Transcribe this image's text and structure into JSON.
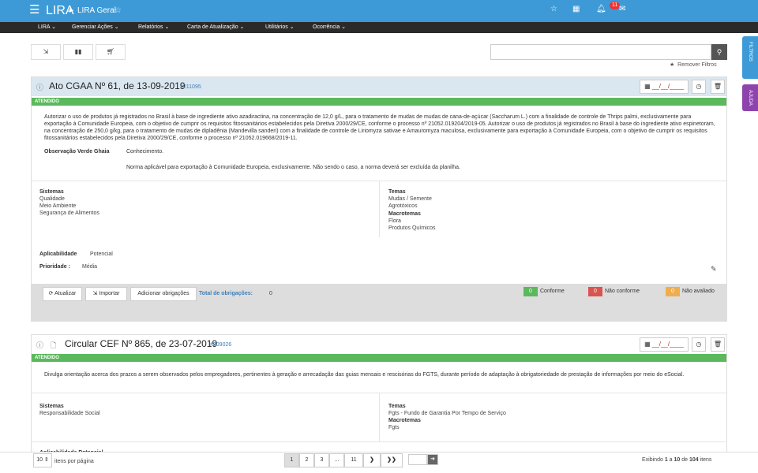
{
  "header": {
    "app": "LIRA",
    "breadcrumb": "LIRA Geral",
    "notif_count": "11"
  },
  "nav": [
    "LIRA ⌄",
    "Gerenciar Ações ⌄",
    "Relatórios ⌄",
    "Carta de Atualização ⌄",
    "Utilitários ⌄",
    "Ocorrência ⌄"
  ],
  "toolbar": {
    "remove_filters": "Remover Filtros"
  },
  "side": {
    "filters": "FILTROS",
    "help": "AJUDA"
  },
  "card1": {
    "title": "Ato CGAA Nº 61, de 13-09-2019",
    "id": "#211095",
    "date": "__/__/____",
    "status": "ATENDIDO",
    "description": "Autorizar o uso de produtos já registrados no Brasil à base de ingrediente ativo azadiractina, na concentração de 12,0 g/L, para o tratamento de mudas de mudas de cana-de-açúcar (Saccharum L.) com a finalidade de controle de Thrips palmi, exclusivamente para exportação à Comunidade Europeia, com o objetivo de cumprir os requisitos fitossanitários estabelecidos pela Diretiva 2000/29/CE, conforme o processo nº 21052.019204/2019-05. Autorizar o uso de produtos já registrados no Brasil à base do ingrediente ativo espinetoram, na concentração de 250,0 g/kg, para o tratamento de mudas de dipladênia (Mandevilla sanderi) com a finalidade de controle de Liriomyza sativae e Amauromyza maculosa, exclusivamente para exportação à Comunidade Europeia, com o objetivo de cumprir os requisitos fitossanitários estabelecidos pela Diretiva 2000/29/CE, conforme o processo nº 21052.019668/2019-11.",
    "obs_label": "Observação Verde Ghaia",
    "obs_value": "Conhecimento.",
    "obs_note": "Norma aplicável para exportação à Comunidade Europeia, exclusivamente. Não sendo o caso, a norma deverá ser excluída da planilha.",
    "sistemas_label": "Sistemas",
    "sistemas": [
      "Qualidade",
      "Meio Ambiente",
      "Segurança de Alimentos"
    ],
    "temas_label": "Temas",
    "temas": [
      "Mudas / Semente",
      "Agrotóxicos"
    ],
    "macro_label": "Macrotemas",
    "macrotemas": [
      "Flora",
      "Produtos Químicos"
    ],
    "aplic_label": "Aplicabilidade",
    "aplic_value": "Potencial",
    "prio_label": "Prioridade :",
    "prio_value": "Média",
    "btn_update": "Atualizar",
    "btn_import": "Importar",
    "btn_add": "Adicionar obrigações",
    "total_label": "Total de obrigações:",
    "total_value": "0",
    "legend": [
      {
        "count": "0",
        "label": "Conforme",
        "color": "#5cb85c"
      },
      {
        "count": "0",
        "label": "Não conforme",
        "color": "#d9534f"
      },
      {
        "count": "0",
        "label": "Não avaliado",
        "color": "#f0ad4e"
      }
    ]
  },
  "card2": {
    "title": "Circular CEF Nº 865, de 23-07-2019",
    "id": "#209026",
    "date": "__/__/____",
    "status": "ATENDIDO",
    "description": "Divulga orientação acerca dos prazos a serem observados pelos empregadores, pertinentes à geração e arrecadação das guias mensais e rescisórias do FGTS, durante período de adaptação à obrigatoriedade de prestação de informações por meio do eSocial.",
    "sistemas_label": "Sistemas",
    "sistemas": [
      "Responsabilidade Social"
    ],
    "temas_label": "Temas",
    "temas": [
      "Fgts - Fundo de Garantia Por Tempo de Serviço"
    ],
    "macro_label": "Macrotemas",
    "macrotemas": [
      "Fgts"
    ],
    "aplic_partial": "Aplicabilidade  Potencial"
  },
  "pagination": {
    "per_page": "10",
    "per_page_label": "itens por página",
    "pages": [
      "1",
      "2",
      "3",
      "...",
      "11"
    ],
    "summary_prefix": "Exibindo",
    "range_from": "1",
    "range_to": "10",
    "total": "104",
    "summary_suffix": "itens"
  }
}
